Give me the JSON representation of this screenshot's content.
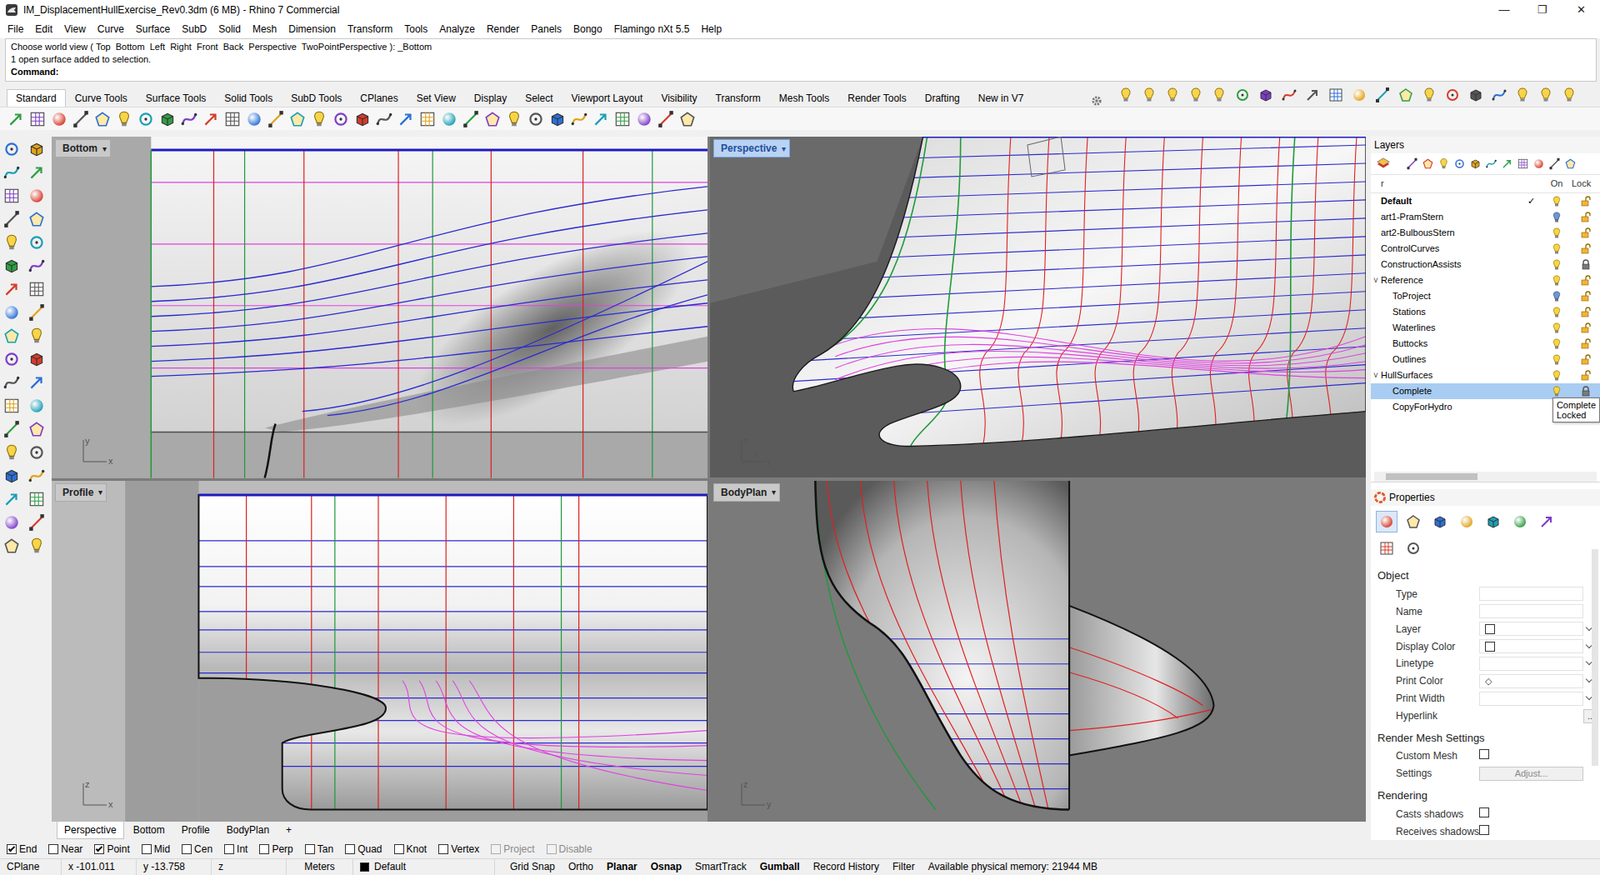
{
  "window": {
    "title": "IM_DisplacementHullExercise_Rev0.3dm (6 MB) - Rhino 7 Commercial",
    "controls": [
      "—",
      "❐",
      "✕"
    ]
  },
  "menu": [
    "File",
    "Edit",
    "View",
    "Curve",
    "Surface",
    "SubD",
    "Solid",
    "Mesh",
    "Dimension",
    "Transform",
    "Tools",
    "Analyze",
    "Render",
    "Panels",
    "Bongo",
    "Flamingo nXt 5.5",
    "Help"
  ],
  "command": {
    "history": [
      "Choose world view ( Top  Bottom  Left  Right  Front  Back  Perspective  TwoPointPerspective ): _Bottom",
      "1 open surface added to selection."
    ],
    "prompt": "Command:"
  },
  "toolbar_tabs": [
    {
      "label": "Standard",
      "selected": true
    },
    {
      "label": "Curve Tools",
      "selected": false
    },
    {
      "label": "Surface Tools",
      "selected": false
    },
    {
      "label": "Solid Tools",
      "selected": false
    },
    {
      "label": "SubD Tools",
      "selected": false
    },
    {
      "label": "CPlanes",
      "selected": false
    },
    {
      "label": "Set View",
      "selected": false
    },
    {
      "label": "Display",
      "selected": false
    },
    {
      "label": "Select",
      "selected": false
    },
    {
      "label": "Viewport Layout",
      "selected": false
    },
    {
      "label": "Visibility",
      "selected": false
    },
    {
      "label": "Transform",
      "selected": false
    },
    {
      "label": "Mesh Tools",
      "selected": false
    },
    {
      "label": "Render Tools",
      "selected": false
    },
    {
      "label": "Drafting",
      "selected": false
    },
    {
      "label": "New in V7",
      "selected": false
    }
  ],
  "viewport_dropdown": "▾",
  "viewports": [
    {
      "label": "Bottom",
      "active": false,
      "kind": "bottom",
      "axes": [
        "x",
        "y"
      ]
    },
    {
      "label": "Perspective",
      "active": true,
      "kind": "perspective",
      "axes": [
        "z",
        "y",
        "x"
      ]
    },
    {
      "label": "Profile",
      "active": false,
      "kind": "profile",
      "axes": [
        "z",
        "x"
      ]
    },
    {
      "label": "BodyPlan",
      "active": false,
      "kind": "bodyplan",
      "axes": [
        "z",
        "y"
      ]
    }
  ],
  "viewport_tabs": [
    {
      "label": "Perspective",
      "selected": true
    },
    {
      "label": "Bottom",
      "selected": false
    },
    {
      "label": "Profile",
      "selected": false
    },
    {
      "label": "BodyPlan",
      "selected": false
    }
  ],
  "viewport_tab_add": "+",
  "layers": {
    "title": "Layers",
    "columns": [
      "r",
      "On",
      "Lock"
    ],
    "current_glyph": "✓",
    "items": [
      {
        "name": "Default",
        "kind": "top",
        "current": true,
        "on": true,
        "locked": false,
        "selected": false
      },
      {
        "name": "art1-PramStern",
        "kind": "top",
        "current": false,
        "on": false,
        "locked": false,
        "selected": false
      },
      {
        "name": "art2-BulbousStern",
        "kind": "top",
        "current": false,
        "on": true,
        "locked": false,
        "selected": false
      },
      {
        "name": "ControlCurves",
        "kind": "top",
        "current": false,
        "on": true,
        "locked": false,
        "selected": false
      },
      {
        "name": "ConstructionAssists",
        "kind": "top",
        "current": false,
        "on": true,
        "locked": true,
        "selected": false
      },
      {
        "name": "Reference",
        "kind": "top",
        "toggle": "˅",
        "expanded": true,
        "current": false,
        "on": true,
        "locked": false,
        "selected": false
      },
      {
        "name": "ToProject",
        "kind": "child",
        "current": false,
        "on": false,
        "locked": false,
        "selected": false
      },
      {
        "name": "Stations",
        "kind": "child",
        "current": false,
        "on": true,
        "locked": false,
        "selected": false
      },
      {
        "name": "Waterlines",
        "kind": "child",
        "current": false,
        "on": true,
        "locked": false,
        "selected": false
      },
      {
        "name": "Buttocks",
        "kind": "child",
        "current": false,
        "on": true,
        "locked": false,
        "selected": false
      },
      {
        "name": "Outlines",
        "kind": "child",
        "current": false,
        "on": true,
        "locked": false,
        "selected": false
      },
      {
        "name": "HullSurfaces",
        "kind": "top",
        "toggle": "˅",
        "expanded": true,
        "current": false,
        "on": true,
        "locked": false,
        "selected": false
      },
      {
        "name": "Complete",
        "kind": "child",
        "current": false,
        "on": true,
        "locked": true,
        "selected": true,
        "tooltip": [
          "Complete",
          "Locked"
        ]
      },
      {
        "name": "CopyForHydro",
        "kind": "child",
        "current": false,
        "on": false,
        "locked": false,
        "selected": false
      }
    ]
  },
  "properties": {
    "title": "Properties",
    "tabs": [
      {
        "selected": true
      },
      {
        "selected": false
      },
      {
        "selected": false
      },
      {
        "selected": false
      },
      {
        "selected": false
      },
      {
        "selected": false
      },
      {
        "selected": false
      },
      {
        "selected": false
      },
      {
        "selected": false
      }
    ],
    "sections": [
      {
        "title": "Object",
        "rows": [
          {
            "label": "Type",
            "kind": "text",
            "value": ""
          },
          {
            "label": "Name",
            "kind": "text",
            "value": ""
          },
          {
            "label": "Layer",
            "kind": "swatch",
            "color": "#ffffff"
          },
          {
            "label": "Display Color",
            "kind": "swatch",
            "color": "#ffffff"
          },
          {
            "label": "Linetype",
            "kind": "dropdown",
            "value": ""
          },
          {
            "label": "Print Color",
            "kind": "dropdown",
            "value": "◇"
          },
          {
            "label": "Print Width",
            "kind": "dropdown",
            "value": ""
          },
          {
            "label": "Hyperlink",
            "kind": "button",
            "value": "...",
            "disabled": false
          }
        ]
      },
      {
        "title": "Render Mesh Settings",
        "rows": [
          {
            "label": "Custom Mesh",
            "kind": "checkbox",
            "checked": false
          },
          {
            "label": "Settings",
            "kind": "button",
            "value": "Adjust...",
            "disabled": true
          }
        ]
      },
      {
        "title": "Rendering",
        "rows": [
          {
            "label": "Casts shadows",
            "kind": "checkbox",
            "checked": false
          },
          {
            "label": "Receives shadows",
            "kind": "checkbox",
            "checked": false
          }
        ]
      }
    ]
  },
  "osnap": [
    {
      "label": "End",
      "checked": true,
      "disabled": false
    },
    {
      "label": "Near",
      "checked": false,
      "disabled": false
    },
    {
      "label": "Point",
      "checked": true,
      "disabled": false
    },
    {
      "label": "Mid",
      "checked": false,
      "disabled": false
    },
    {
      "label": "Cen",
      "checked": false,
      "disabled": false
    },
    {
      "label": "Int",
      "checked": false,
      "disabled": false
    },
    {
      "label": "Perp",
      "checked": false,
      "disabled": false
    },
    {
      "label": "Tan",
      "checked": false,
      "disabled": false
    },
    {
      "label": "Quad",
      "checked": false,
      "disabled": false
    },
    {
      "label": "Knot",
      "checked": false,
      "disabled": false
    },
    {
      "label": "Vertex",
      "checked": false,
      "disabled": false
    },
    {
      "label": "Project",
      "checked": false,
      "disabled": true
    },
    {
      "label": "Disable",
      "checked": false,
      "disabled": true
    }
  ],
  "status_bar": {
    "cplane": "CPlane",
    "x": "x -101.011",
    "y": "y -13.758",
    "z": "z",
    "units": "Meters",
    "layer": {
      "name": "Default",
      "color": "#000000"
    },
    "toggles": [
      {
        "label": "Grid Snap",
        "on": false
      },
      {
        "label": "Ortho",
        "on": false
      },
      {
        "label": "Planar",
        "on": true
      },
      {
        "label": "Osnap",
        "on": true
      },
      {
        "label": "SmartTrack",
        "on": false
      },
      {
        "label": "Gumball",
        "on": true
      },
      {
        "label": "Record History",
        "on": false
      },
      {
        "label": "Filter",
        "on": false
      }
    ],
    "memory": "Available physical memory: 21944 MB"
  }
}
